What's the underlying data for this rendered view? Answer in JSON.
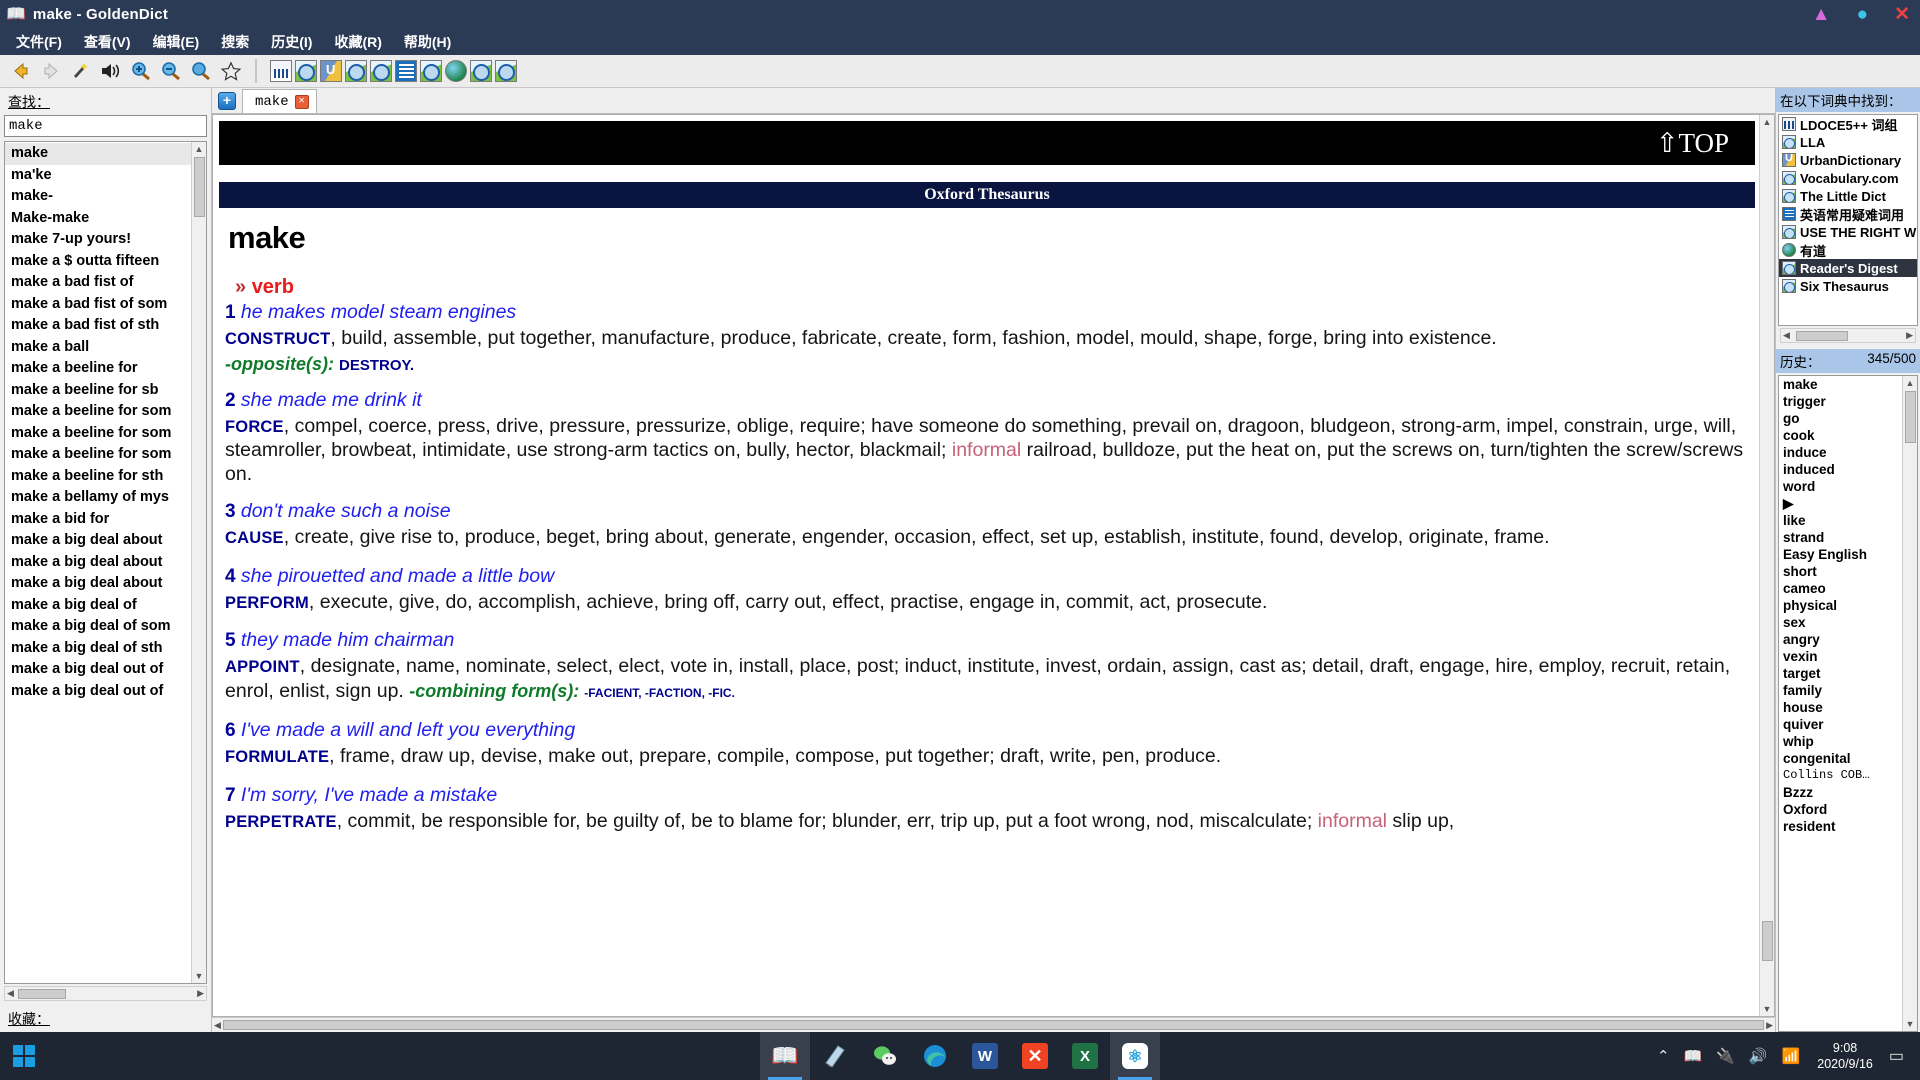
{
  "window": {
    "title": "make - GoldenDict",
    "icon": "book-icon",
    "minimize": "▲",
    "maximize": "●",
    "close": "✕"
  },
  "menubar": {
    "items": [
      {
        "label": "文件(F)",
        "name": "menu-file"
      },
      {
        "label": "查看(V)",
        "name": "menu-view"
      },
      {
        "label": "编辑(E)",
        "name": "menu-edit"
      },
      {
        "label": "搜索",
        "name": "menu-search"
      },
      {
        "label": "历史(I)",
        "name": "menu-history"
      },
      {
        "label": "收藏(R)",
        "name": "menu-favorites"
      },
      {
        "label": "帮助(H)",
        "name": "menu-help"
      }
    ]
  },
  "toolbar": {
    "buttons": [
      {
        "name": "back-icon",
        "glyph": "◀"
      },
      {
        "name": "forward-icon",
        "glyph": "▶"
      },
      {
        "name": "scan-popup-icon",
        "glyph": "✨"
      },
      {
        "name": "pronounce-icon",
        "glyph": "🔊"
      },
      {
        "name": "zoom-in-icon",
        "glyph": "⊕"
      },
      {
        "name": "zoom-out-icon",
        "glyph": "⊖"
      },
      {
        "name": "zoom-reset-icon",
        "glyph": "⊙"
      },
      {
        "name": "add-favorite-icon",
        "glyph": "☆"
      }
    ],
    "dictionary_icons": [
      {
        "name": "dict-icon-ldoce",
        "kind": "lib"
      },
      {
        "name": "dict-icon-lla",
        "kind": "blue"
      },
      {
        "name": "dict-icon-urbandictionary",
        "kind": "urban"
      },
      {
        "name": "dict-icon-vocabulary",
        "kind": "blue"
      },
      {
        "name": "dict-icon-little-dict",
        "kind": "blue"
      },
      {
        "name": "dict-icon-chinese-hard-words",
        "kind": "book"
      },
      {
        "name": "dict-icon-use-the-right-word",
        "kind": "blue"
      },
      {
        "name": "dict-icon-youdao",
        "kind": "globe"
      },
      {
        "name": "dict-icon-readers-digest",
        "kind": "blue"
      },
      {
        "name": "dict-icon-six-thesaurus",
        "kind": "blue"
      }
    ]
  },
  "left_pane": {
    "search_label": "查找：",
    "search_value": "make",
    "search_placeholder": "查找",
    "favorites_label": "收藏：",
    "words": [
      "make",
      "ma'ke",
      "make-",
      "Make-make",
      "make 7-up yours!",
      "make a $ outta fifteen",
      "make a bad fist of",
      "make a bad fist of som",
      "make a bad fist of sth",
      "make a ball",
      "make a beeline for",
      "make a beeline for sb",
      "make a beeline for som",
      "make a beeline for som",
      "make a beeline for som",
      "make a beeline for sth",
      "make a bellamy of mys",
      "make a bid for",
      "make a big deal about",
      "make a big deal about",
      "make a big deal about",
      "make a big deal of",
      "make a big deal of som",
      "make a big deal of sth",
      "make a big deal out of",
      "make a big deal out of"
    ],
    "selected_word": "make"
  },
  "tabs": {
    "add_label": "+",
    "items": [
      {
        "label": "make",
        "close": "✕"
      }
    ]
  },
  "article": {
    "top_link": "⇧TOP",
    "dictionary_name": "Oxford Thesaurus",
    "headword": "make",
    "pos_chevron": "»",
    "pos": "verb",
    "senses": [
      {
        "num": "1",
        "example": "he makes model steam engines",
        "key": "CONSTRUCT",
        "synonyms": ", build, assemble, put together, manufacture, produce, fabricate, create, form, fashion, model, mould, shape, forge, bring into existence.",
        "opposite_label": "-opposite(s):",
        "opposite_words": "DESTROY."
      },
      {
        "num": "2",
        "example": "she made me drink it",
        "key": "FORCE",
        "synonyms": ", compel, coerce, press, drive, pressure, pressurize, oblige, require; have someone do something, prevail on, dragoon, bludgeon, strong-arm, impel, constrain, urge, will, steamroller, browbeat, intimidate, use strong-arm tactics on, bully, hector, blackmail; ",
        "register_label": "informal",
        "synonyms_tail": " railroad, bulldoze, put the heat on, put the screws on, turn/tighten the screw/screws on."
      },
      {
        "num": "3",
        "example": "don't make such a noise",
        "key": "CAUSE",
        "synonyms": ", create, give rise to, produce, beget, bring about, generate, engender, occasion, effect, set up, establish, institute, found, develop, originate, frame."
      },
      {
        "num": "4",
        "example": "she pirouetted and made a little bow",
        "key": "PERFORM",
        "synonyms": ", execute, give, do, accomplish, achieve, bring off, carry out, effect, practise, engage in, commit, act, prosecute."
      },
      {
        "num": "5",
        "example": "they made him chairman",
        "key": "APPOINT",
        "synonyms": ", designate, name, nominate, select, elect, vote in, install, place, post; induct, institute, invest, ordain, assign, cast as; detail, draft, engage, hire, employ, recruit, retain, enrol, enlist, sign up.  ",
        "combining_label": "-combining form(s):",
        "combining_words": "-FACIENT, -FACTION, -FIC."
      },
      {
        "num": "6",
        "example": "I've made a will and left you everything",
        "key": "FORMULATE",
        "synonyms": ", frame, draw up, devise, make out, prepare, compile, compose, put together; draft, write, pen, produce."
      },
      {
        "num": "7",
        "example": "I'm sorry, I've made a mistake",
        "key": "PERPETRATE",
        "synonyms": ", commit, be responsible for, be guilty of, be to blame for; blunder, err, trip up, put a foot wrong, nod, miscalculate; ",
        "register_label": "informal",
        "synonyms_tail": " slip up,"
      }
    ]
  },
  "right_pane": {
    "dict_title": "在以下词典中找到：",
    "dictionaries": [
      {
        "label": "LDOCE5++ 词组",
        "icon": "lib"
      },
      {
        "label": "LLA",
        "icon": "magn"
      },
      {
        "label": "UrbanDictionary",
        "icon": "urb"
      },
      {
        "label": "Vocabulary.com",
        "icon": "magn"
      },
      {
        "label": "The Little Dict",
        "icon": "magn"
      },
      {
        "label": "英语常用疑难词用",
        "icon": "bk"
      },
      {
        "label": "USE THE RIGHT W",
        "icon": "magn"
      },
      {
        "label": "有道",
        "icon": "glb"
      },
      {
        "label": "Reader's Digest",
        "icon": "magn",
        "selected": true
      },
      {
        "label": "Six Thesaurus",
        "icon": "magn"
      }
    ],
    "history_title": "历史：",
    "history_count": "345/500",
    "history": [
      {
        "w": "make"
      },
      {
        "w": "trigger"
      },
      {
        "w": "go"
      },
      {
        "w": "cook"
      },
      {
        "w": "induce"
      },
      {
        "w": "induced"
      },
      {
        "w": "word"
      },
      {
        "w": "▶"
      },
      {
        "w": "like"
      },
      {
        "w": "strand"
      },
      {
        "w": "Easy English"
      },
      {
        "w": "short"
      },
      {
        "w": "cameo"
      },
      {
        "w": "physical"
      },
      {
        "w": "sex"
      },
      {
        "w": "angry"
      },
      {
        "w": "vexin"
      },
      {
        "w": "target"
      },
      {
        "w": "family"
      },
      {
        "w": "house"
      },
      {
        "w": "quiver"
      },
      {
        "w": "whip"
      },
      {
        "w": "congenital"
      },
      {
        "w": "Collins COB…",
        "mono": true
      },
      {
        "w": "Bzzz"
      },
      {
        "w": "Oxford"
      },
      {
        "w": "resident"
      }
    ]
  },
  "taskbar": {
    "start_name": "start-button",
    "items": [
      {
        "name": "taskbar-goldendict",
        "glyph": "📖",
        "active": true
      },
      {
        "name": "taskbar-notepad",
        "glyph": "📝",
        "active": false
      },
      {
        "name": "taskbar-wechat",
        "glyph": "💬",
        "active": false
      },
      {
        "name": "taskbar-edge",
        "glyph": "🌀",
        "active": false
      },
      {
        "name": "taskbar-word",
        "glyph": "W",
        "active": false
      },
      {
        "name": "taskbar-xmind",
        "glyph": "✕",
        "active": false
      },
      {
        "name": "taskbar-excel",
        "glyph": "X",
        "active": false
      },
      {
        "name": "taskbar-baidu-netdisk",
        "glyph": "☁",
        "active": true
      }
    ],
    "tray": [
      {
        "name": "tray-chevron-icon",
        "glyph": "⌃"
      },
      {
        "name": "tray-goldendict-icon",
        "glyph": "📖"
      },
      {
        "name": "tray-battery-icon",
        "glyph": "🔋"
      },
      {
        "name": "tray-volume-icon",
        "glyph": "🔊"
      },
      {
        "name": "tray-wifi-icon",
        "glyph": "📶"
      }
    ],
    "time": "9:08",
    "date": "2020/9/16",
    "notification": "▭"
  },
  "colors": {
    "titlebar": "#2b3a55",
    "dict_header": "#0a1440",
    "accent_blue": "#2020ee",
    "key_blue": "#00008c",
    "pos_red": "#e81c1c",
    "opposite_green": "#0f7a2a",
    "register_pink": "#c8607a",
    "selection_dark": "#2e3440",
    "rp_title_bg": "#a9c6e8"
  }
}
